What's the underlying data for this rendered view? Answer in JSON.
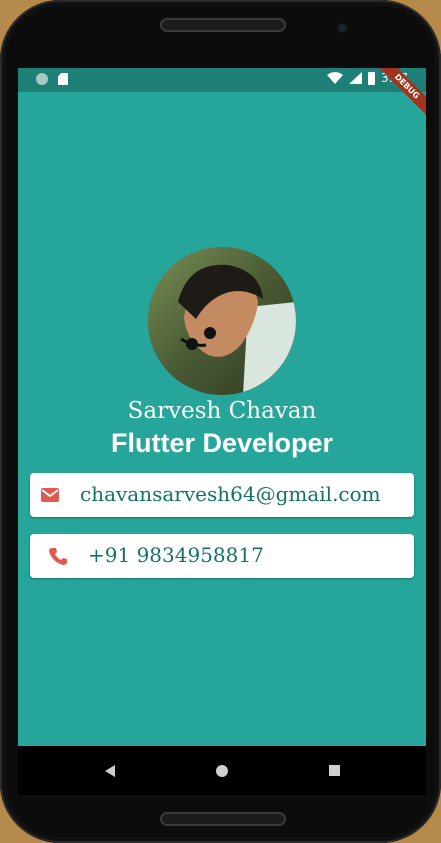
{
  "status_bar": {
    "time": "3:57",
    "debug_label": "DEBUG"
  },
  "profile": {
    "name": "Sarvesh Chavan",
    "title": "Flutter Developer"
  },
  "contacts": {
    "email": "chavansarvesh64@gmail.com",
    "phone": "+91 9834958817"
  },
  "colors": {
    "background": "#26a69a",
    "status_bar": "#1d7f76",
    "card_text": "#137267",
    "icon_red": "#e05a4f"
  },
  "icons": {
    "email": "mail-icon",
    "phone": "phone-icon"
  }
}
